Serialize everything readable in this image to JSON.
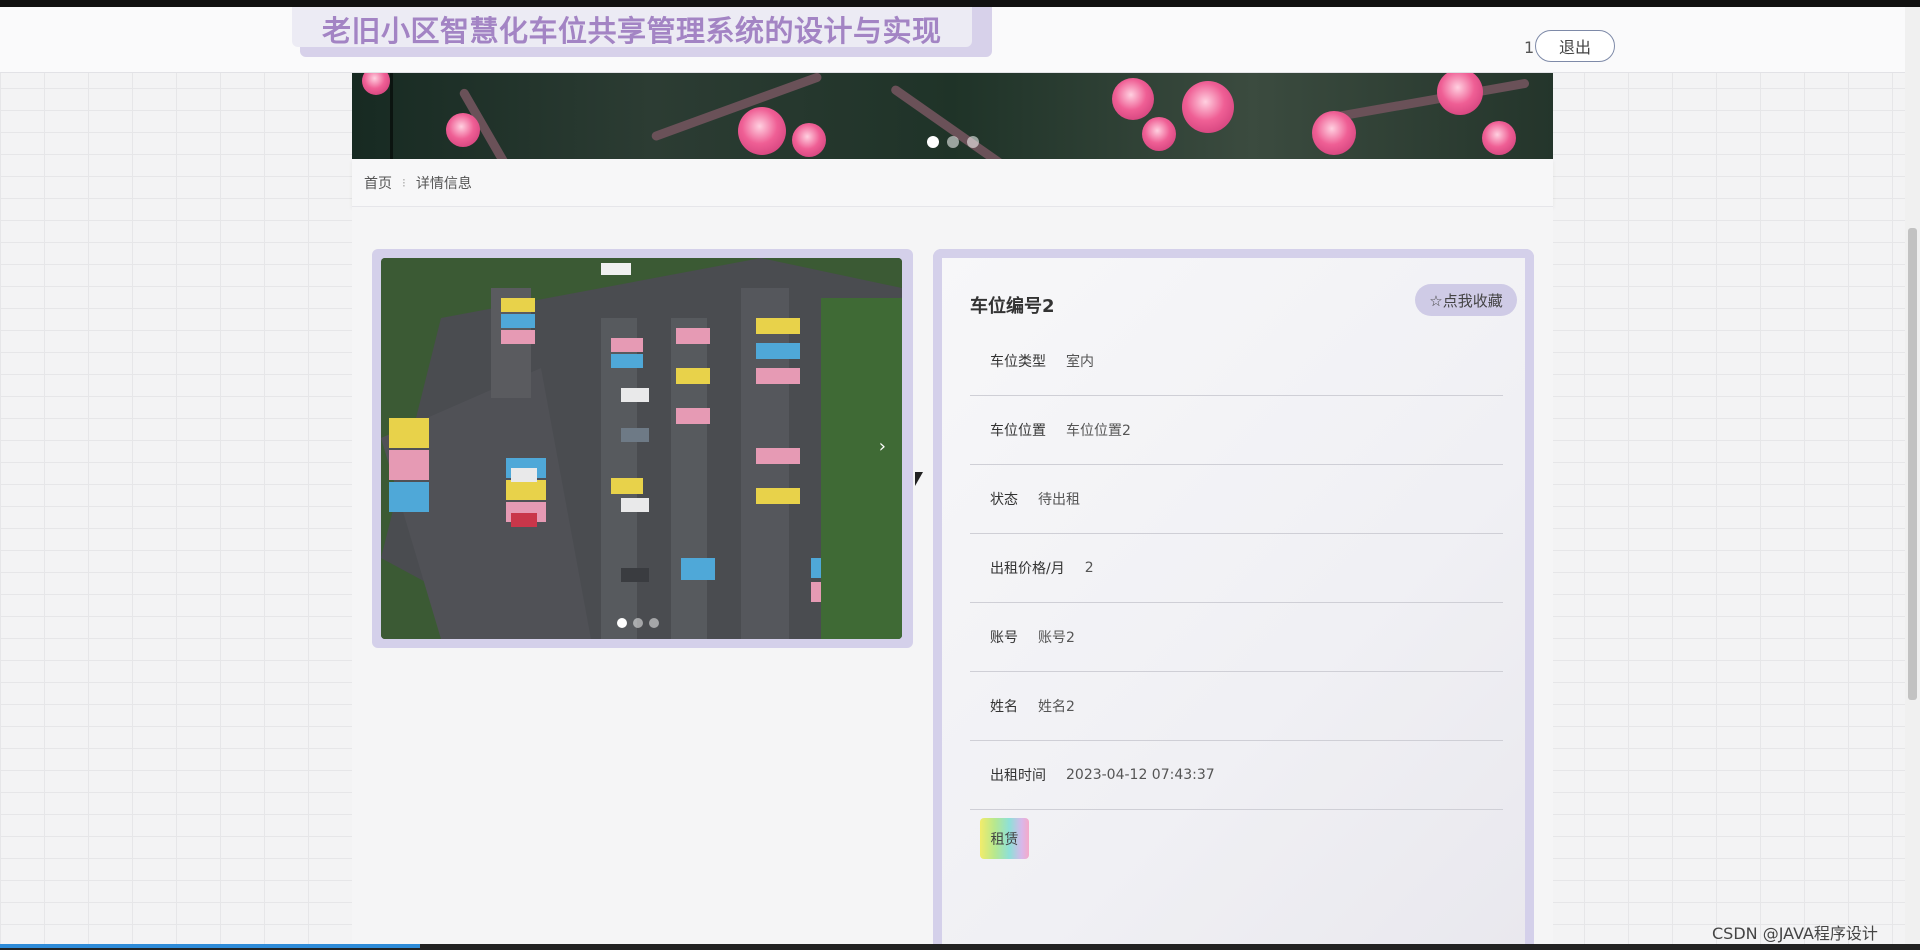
{
  "header": {
    "title": "老旧小区智慧化车位共享管理系统的设计与实现",
    "user_count": "1",
    "logout_label": "退出"
  },
  "banner": {
    "slides": 3,
    "active_slide": 1
  },
  "breadcrumb": {
    "home": "首页",
    "separator": "⁝",
    "current": "详情信息"
  },
  "gallery": {
    "next_label": "›",
    "slides": 3,
    "active_slide": 1
  },
  "detail": {
    "title": "车位编号2",
    "favorite_label": "☆点我收藏",
    "rows": [
      {
        "label": "车位类型",
        "value": "室内"
      },
      {
        "label": "车位位置",
        "value": "车位位置2"
      },
      {
        "label": "状态",
        "value": "待出租"
      },
      {
        "label": "出租价格/月",
        "value": "2"
      },
      {
        "label": "账号",
        "value": "账号2"
      },
      {
        "label": "姓名",
        "value": "姓名2"
      },
      {
        "label": "出租时间",
        "value": "2023-04-12 07:43:37"
      }
    ],
    "rent_label": "租赁"
  },
  "footer": {
    "watermark": "CSDN @JAVA程序设计"
  },
  "colors": {
    "accent": "#d4d0ea",
    "title": "#a384c4"
  }
}
